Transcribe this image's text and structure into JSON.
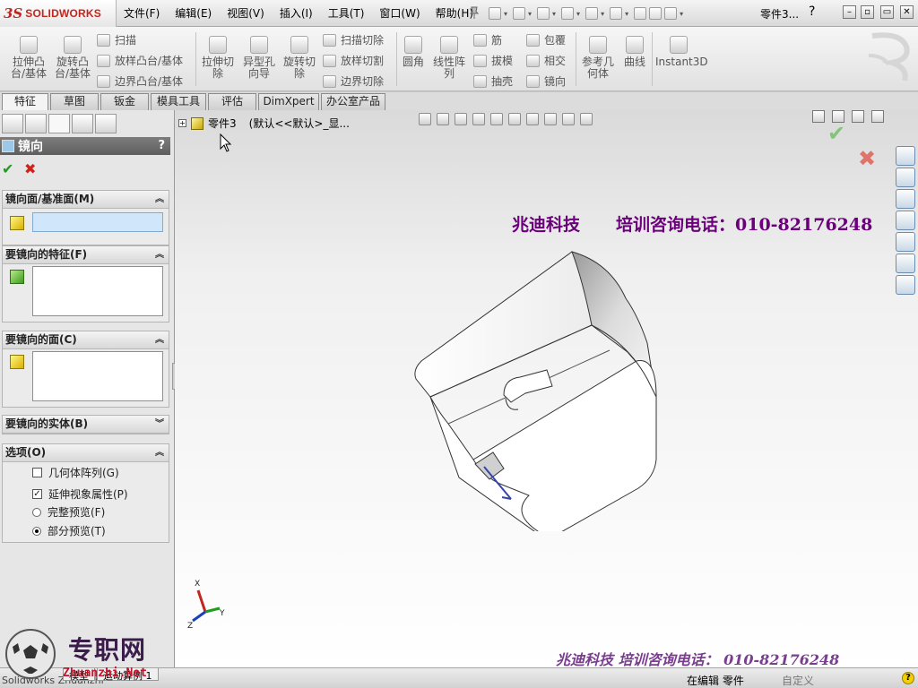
{
  "app": {
    "brand_ds": "3S",
    "brand_name": "SOLIDWORKS",
    "document_title": "零件3...",
    "help_glyph": "?"
  },
  "menu": [
    "文件(F)",
    "编辑(E)",
    "视图(V)",
    "插入(I)",
    "工具(T)",
    "窗口(W)",
    "帮助(H)"
  ],
  "ribbon": {
    "big": [
      {
        "label1": "拉伸凸",
        "label2": "台/基体"
      },
      {
        "label1": "旋转凸",
        "label2": "台/基体"
      },
      {
        "label1": "拉伸切",
        "label2": "除"
      },
      {
        "label1": "异型孔",
        "label2": "向导"
      },
      {
        "label1": "旋转切",
        "label2": "除"
      },
      {
        "label1": "圆角",
        "label2": ""
      },
      {
        "label1": "线性阵",
        "label2": "列"
      },
      {
        "label1": "参考几",
        "label2": "何体"
      },
      {
        "label1": "曲线",
        "label2": ""
      },
      {
        "label1": "Instant3D",
        "label2": ""
      }
    ],
    "small": [
      "扫描",
      "放样凸台/基体",
      "边界凸台/基体",
      "扫描切除",
      "放样切割",
      "边界切除",
      "筋",
      "拔模",
      "抽壳",
      "包覆",
      "相交",
      "镜向"
    ]
  },
  "tabs": [
    "特征",
    "草图",
    "钣金",
    "模具工具",
    "评估",
    "DimXpert",
    "办公室产品"
  ],
  "property_manager": {
    "title": "镜向",
    "help": "?",
    "ok": "✔",
    "cancel": "✖",
    "groups": {
      "mirror_plane": "镜向面/基准面(M)",
      "features": "要镜向的特征(F)",
      "faces": "要镜向的面(C)",
      "bodies": "要镜向的实体(B)",
      "options": "选项(O)"
    },
    "options": {
      "geometry_pattern": "几何体阵列(G)",
      "geometry_pattern_checked": false,
      "propagate_visual": "延伸视象属性(P)",
      "propagate_visual_checked": true,
      "full_preview": "完整预览(F)",
      "partial_preview": "部分预览(T)",
      "selected_preview": "partial"
    }
  },
  "graphics": {
    "tree_node": "零件3",
    "tree_config": "(默认<<默认>_显...",
    "overlay_top": "兆迪科技",
    "overlay_top_phone": "培训咨询电话：010-82176248",
    "overlay_bottom": "兆迪科技  培训咨询电话：  010-82176248",
    "triad_labels": {
      "x": "X",
      "y": "Y",
      "z": "Z"
    }
  },
  "status": {
    "left_text": "Solidworks Zhuanzhi",
    "tabs": [
      "模型",
      "运动算例 1"
    ],
    "editing": "在编辑  零件",
    "custom": "自定义"
  },
  "watermark": {
    "site_name": "专职网",
    "site_url": "Zhuanzhi.Net"
  }
}
